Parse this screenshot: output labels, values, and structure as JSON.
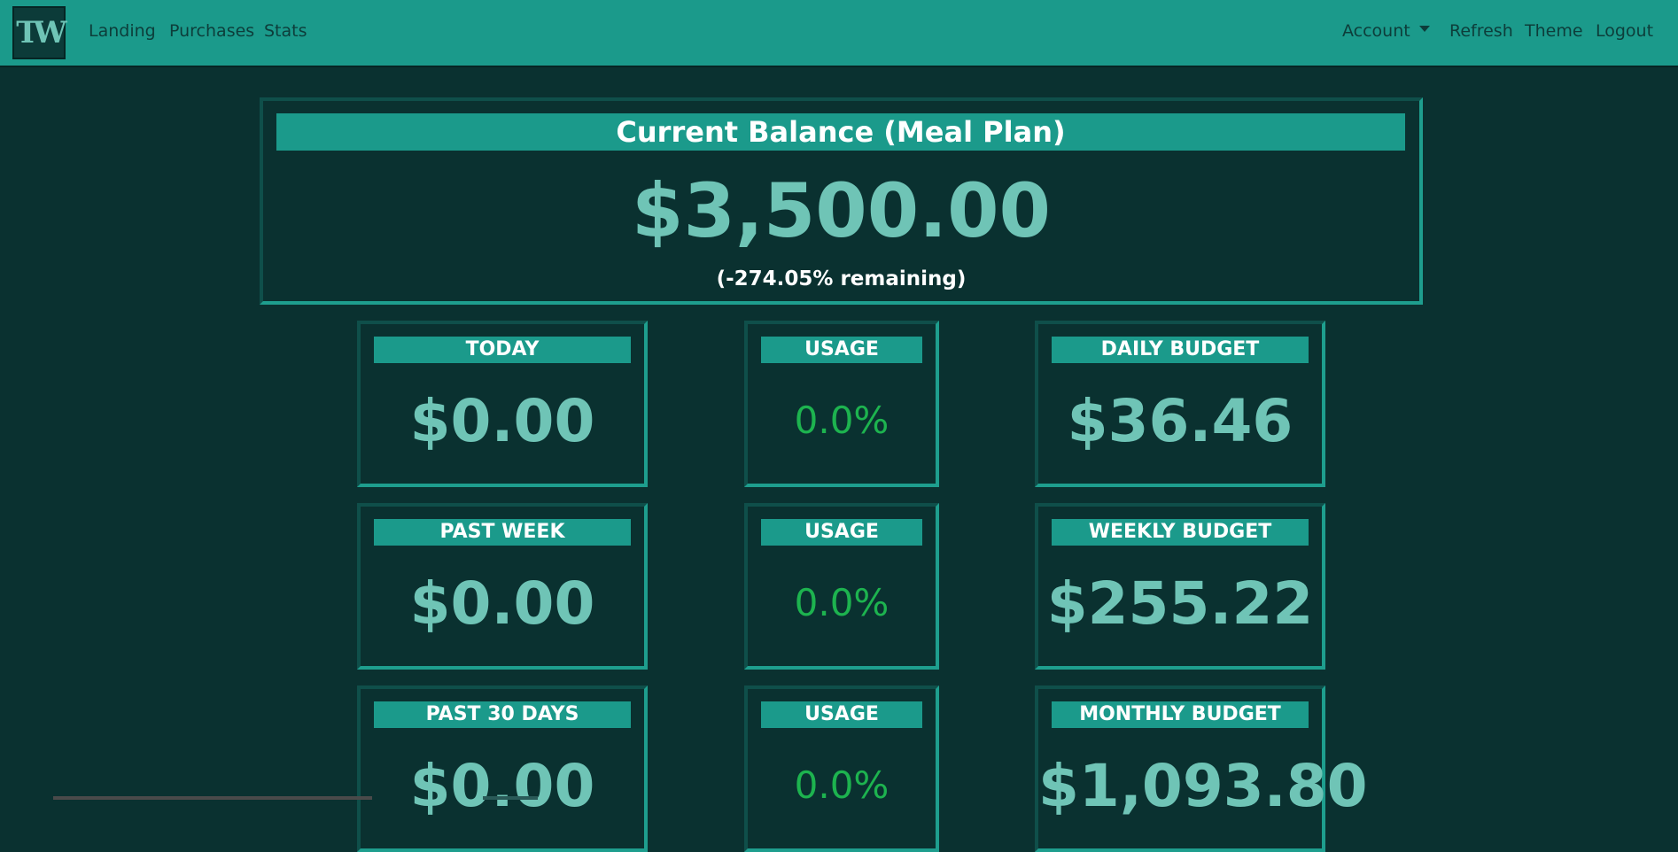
{
  "nav": {
    "logo_text": "TW",
    "links": [
      "Landing",
      "Purchases",
      "Stats"
    ],
    "account_label": "Account",
    "refresh_label": "Refresh",
    "theme_label": "Theme",
    "logout_label": "Logout"
  },
  "balance": {
    "title": "Current Balance (Meal Plan)",
    "value": "$3,500.00",
    "remaining": "(-274.05% remaining)"
  },
  "rows": [
    {
      "spent_label": "TODAY",
      "spent_value": "$0.00",
      "usage_label": "USAGE",
      "usage_value": "0.0%",
      "budget_label": "DAILY BUDGET",
      "budget_value": "$36.46"
    },
    {
      "spent_label": "PAST WEEK",
      "spent_value": "$0.00",
      "usage_label": "USAGE",
      "usage_value": "0.0%",
      "budget_label": "WEEKLY BUDGET",
      "budget_value": "$255.22"
    },
    {
      "spent_label": "PAST 30 DAYS",
      "spent_value": "$0.00",
      "usage_label": "USAGE",
      "usage_value": "0.0%",
      "budget_label": "MONTHLY BUDGET",
      "budget_value": "$1,093.80"
    }
  ],
  "colors": {
    "nav_bg": "#1b9a8b",
    "page_bg": "#0a3130",
    "value_text": "#6fc4b6",
    "usage_text": "#1db34f"
  }
}
